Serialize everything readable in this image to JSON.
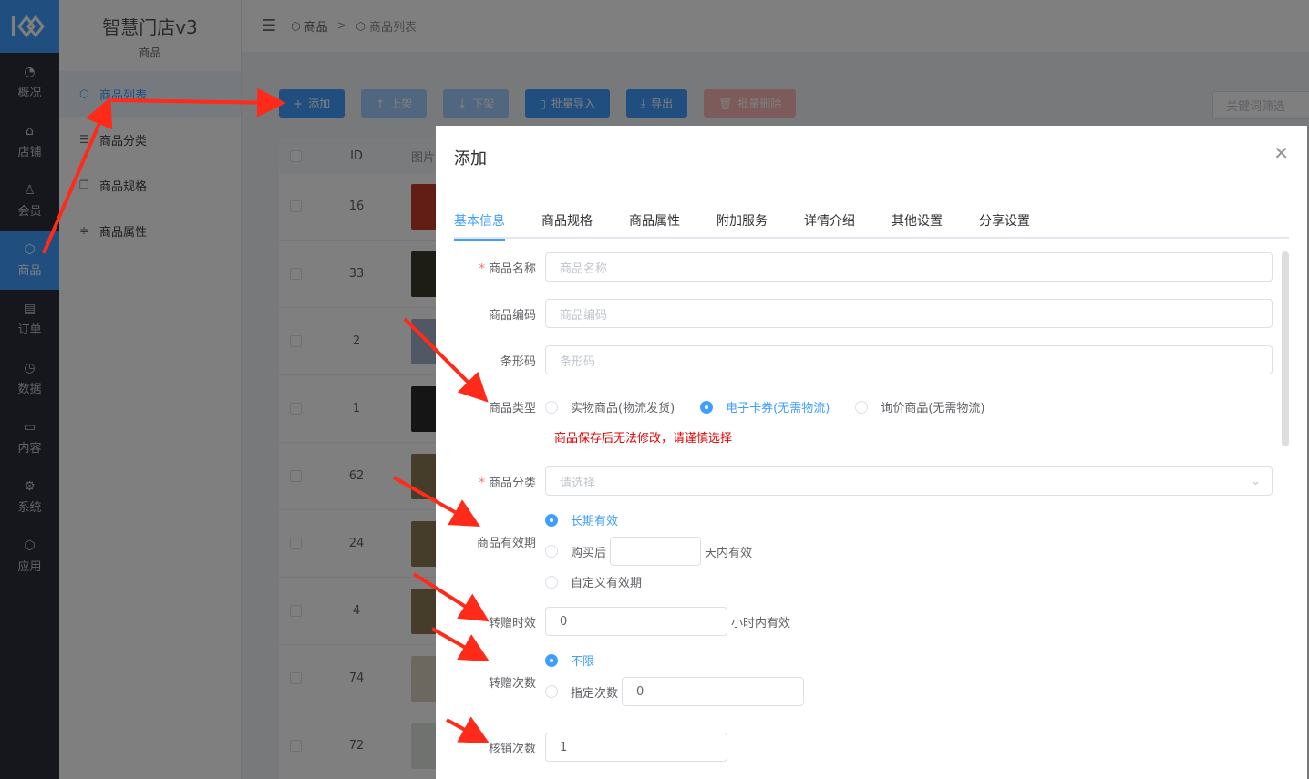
{
  "brand": {
    "title": "智慧门店v3",
    "section": "商品"
  },
  "rail": [
    {
      "label": "概况",
      "icon": "dashboard-icon"
    },
    {
      "label": "店铺",
      "icon": "store-icon"
    },
    {
      "label": "会员",
      "icon": "user-icon"
    },
    {
      "label": "商品",
      "icon": "box-icon"
    },
    {
      "label": "订单",
      "icon": "clipboard-icon"
    },
    {
      "label": "数据",
      "icon": "clock-icon"
    },
    {
      "label": "内容",
      "icon": "folder-icon"
    },
    {
      "label": "系统",
      "icon": "gear-icon"
    },
    {
      "label": "应用",
      "icon": "box-icon"
    }
  ],
  "submenu": [
    {
      "label": "商品列表",
      "icon": "box-icon"
    },
    {
      "label": "商品分类",
      "icon": "list-icon"
    },
    {
      "label": "商品规格",
      "icon": "copy-icon"
    },
    {
      "label": "商品属性",
      "icon": "sliders-icon"
    }
  ],
  "breadcrumb": {
    "first": "商品",
    "second": "商品列表"
  },
  "toolbar": {
    "add": "添加",
    "up": "上架",
    "down": "下架",
    "import": "批量导入",
    "export": "导出",
    "delete": "批量删除",
    "keyword_placeholder": "关键词筛选"
  },
  "table": {
    "headers": {
      "id": "ID",
      "image": "图片"
    },
    "ids": [
      "16",
      "33",
      "2",
      "1",
      "62",
      "24",
      "4",
      "74",
      "72"
    ]
  },
  "dialog": {
    "title": "添加",
    "tabs": [
      "基本信息",
      "商品规格",
      "商品属性",
      "附加服务",
      "详情介绍",
      "其他设置",
      "分享设置"
    ],
    "name_label": "商品名称",
    "name_placeholder": "商品名称",
    "code_label": "商品编码",
    "code_placeholder": "商品编码",
    "barcode_label": "条形码",
    "barcode_placeholder": "条形码",
    "type_label": "商品类型",
    "type_options": [
      "实物商品(物流发货)",
      "电子卡券(无需物流)",
      "询价商品(无需物流)"
    ],
    "type_warning": "商品保存后无法修改，请谨慎选择",
    "category_label": "商品分类",
    "category_placeholder": "请选择",
    "validity_label": "商品有效期",
    "validity_long": "长期有效",
    "validity_after": "购买后",
    "validity_after_suffix": "天内有效",
    "validity_custom": "自定义有效期",
    "gift_time_label": "转赠时效",
    "gift_time_value": "0",
    "gift_time_suffix": "小时内有效",
    "gift_count_label": "转赠次数",
    "gift_unlimited": "不限",
    "gift_specified": "指定次数",
    "gift_specified_value": "0",
    "verify_label": "核销次数",
    "verify_value": "1"
  },
  "colors": {
    "primary": "#409eff",
    "danger": "#f56c6c",
    "warning_text": "#e60000",
    "annotation": "#ff2a1a"
  }
}
